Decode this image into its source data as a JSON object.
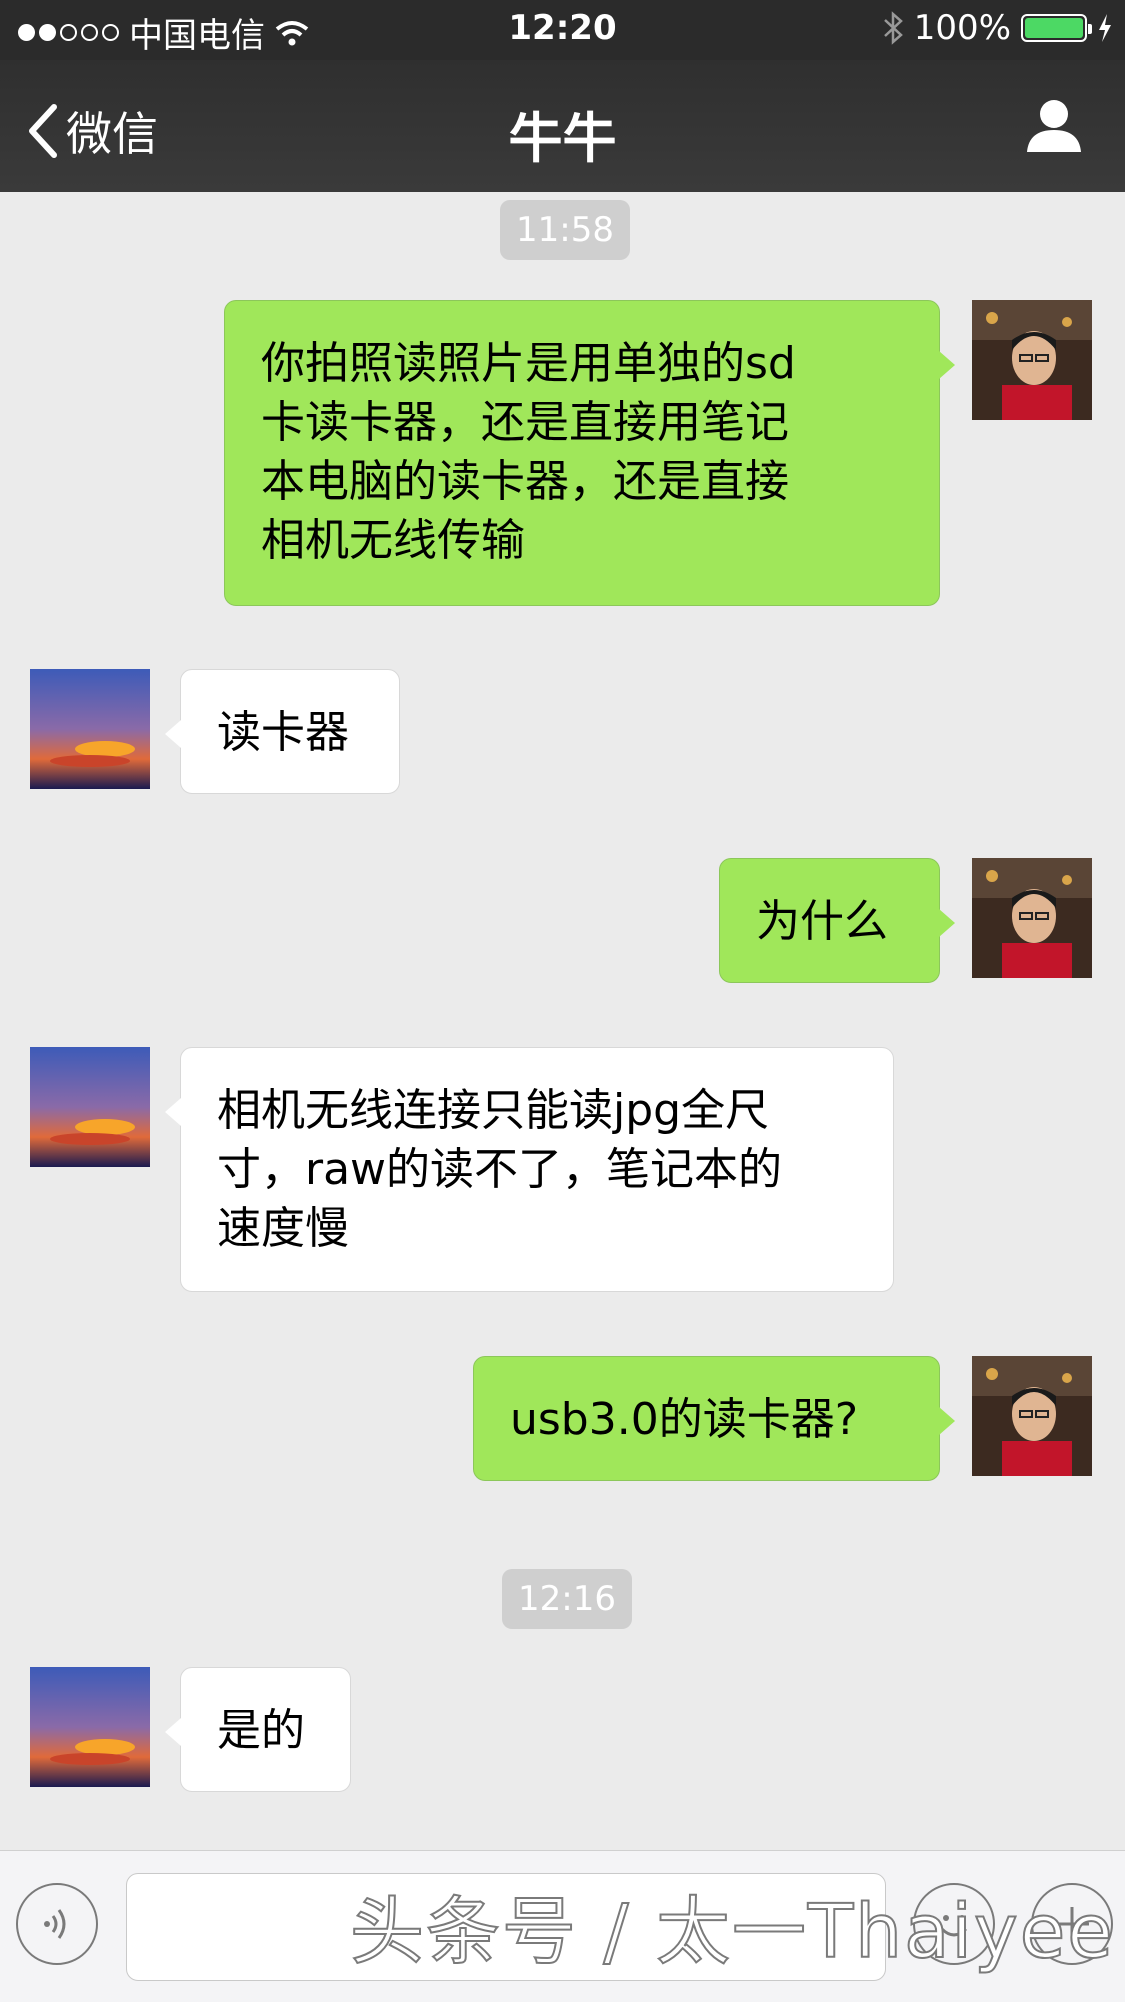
{
  "status_bar": {
    "carrier": "中国电信",
    "time": "12:20",
    "battery": "100%",
    "battery_level": 1.0
  },
  "nav": {
    "back_label": "微信",
    "title": "牛牛"
  },
  "chat": {
    "timestamps": [
      "11:58",
      "12:16"
    ],
    "messages": [
      {
        "from": "me",
        "text": "你拍照读照片是用单独的sd\n卡读卡器，还是直接用笔记\n本电脑的读卡器，还是直接\n相机无线传输"
      },
      {
        "from": "them",
        "text": "读卡器"
      },
      {
        "from": "me",
        "text": "为什么"
      },
      {
        "from": "them",
        "text": "相机无线连接只能读jpg全尺\n寸，raw的读不了，笔记本的\n速度慢"
      },
      {
        "from": "me",
        "text": "usb3.0的读卡器?"
      },
      {
        "from": "them",
        "text": "是的"
      }
    ]
  },
  "watermark": "头条号 / 太一Thaiyee"
}
